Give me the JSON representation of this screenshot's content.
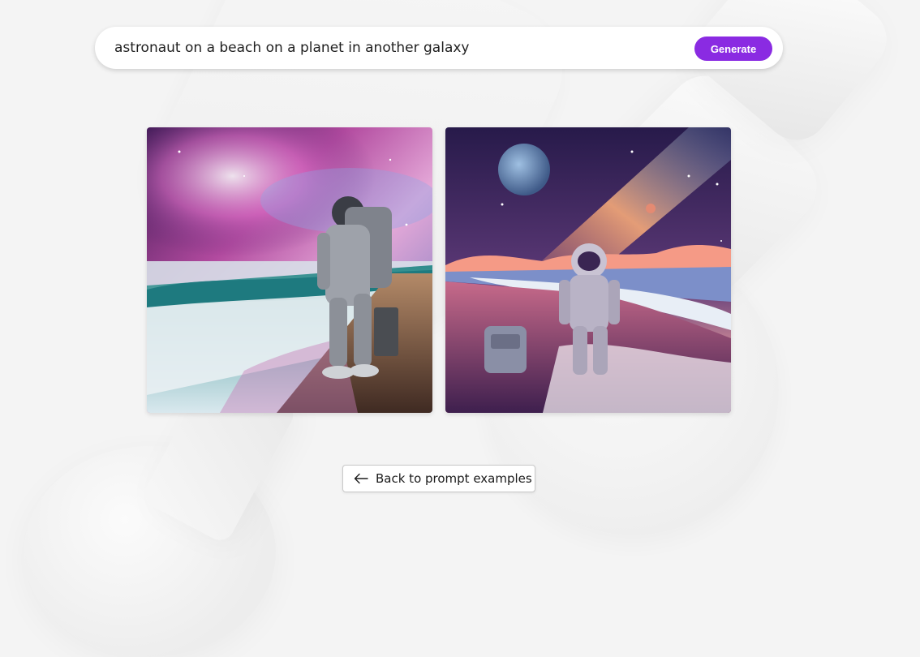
{
  "prompt": {
    "value": "astronaut on a beach on a planet in another galaxy",
    "generate_label": "Generate"
  },
  "results": {
    "images": [
      {
        "name": "astronaut-beach-image-1",
        "icon": "generated-image"
      },
      {
        "name": "astronaut-beach-image-2",
        "icon": "generated-image"
      }
    ]
  },
  "back": {
    "label": "Back to prompt examples",
    "icon": "arrow-left-icon"
  },
  "colors": {
    "accent": "#8a2be2",
    "background": "#f4f4f4",
    "text": "#1f1f1f"
  }
}
